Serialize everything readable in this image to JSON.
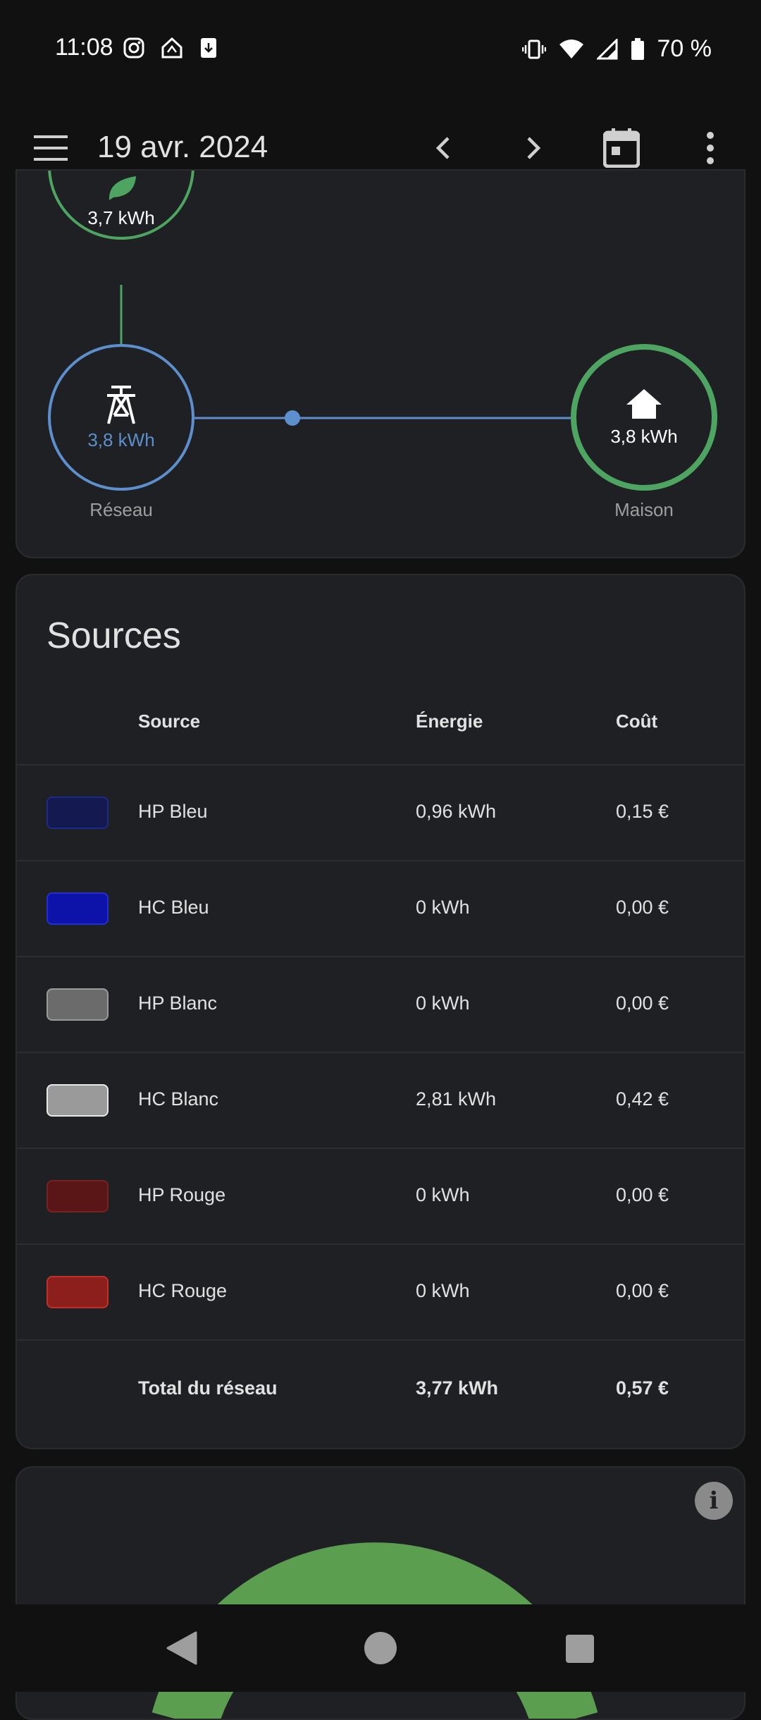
{
  "status_bar": {
    "time": "11:08",
    "battery": "70 %",
    "icons_left": [
      "instagram-icon",
      "home-assistant-icon",
      "download-icon"
    ],
    "icons_right": [
      "vibrate-icon",
      "wifi-icon",
      "signal-icon",
      "battery-icon"
    ]
  },
  "app_bar": {
    "date": "19 avr. 2024",
    "icons": [
      "menu-icon",
      "chevron-left-icon",
      "chevron-right-icon",
      "calendar-icon",
      "more-vert-icon"
    ]
  },
  "energy_flow": {
    "solar": {
      "value": "3,7 kWh",
      "icon": "leaf-icon"
    },
    "grid": {
      "value": "3,8 kWh",
      "label": "Réseau",
      "icon": "transmission-tower-icon"
    },
    "home": {
      "value": "3,8 kWh",
      "label": "Maison",
      "icon": "home-icon"
    },
    "colors": {
      "solar": "#4ea561",
      "grid": "#5c8fcc",
      "home": "#4ea561"
    }
  },
  "sources": {
    "title": "Sources",
    "headers": {
      "source": "Source",
      "energy": "Énergie",
      "cost": "Coût"
    },
    "rows": [
      {
        "name": "HP Bleu",
        "energy": "0,96 kWh",
        "cost": "0,15 €",
        "fill": "#141a4f",
        "border": "#1e2a8a"
      },
      {
        "name": "HC Bleu",
        "energy": "0 kWh",
        "cost": "0,00 €",
        "fill": "#0d13a8",
        "border": "#2030d0"
      },
      {
        "name": "HP Blanc",
        "energy": "0 kWh",
        "cost": "0,00 €",
        "fill": "#6b6b6b",
        "border": "#9a9a9a"
      },
      {
        "name": "HC Blanc",
        "energy": "2,81 kWh",
        "cost": "0,42 €",
        "fill": "#9a9a9a",
        "border": "#e8e8e8"
      },
      {
        "name": "HP Rouge",
        "energy": "0 kWh",
        "cost": "0,00 €",
        "fill": "#5a1616",
        "border": "#7a2020"
      },
      {
        "name": "HC Rouge",
        "energy": "0 kWh",
        "cost": "0,00 €",
        "fill": "#8c1f1c",
        "border": "#c03028"
      }
    ],
    "total": {
      "label": "Total du réseau",
      "energy": "3,77 kWh",
      "cost": "0,57 €"
    }
  },
  "gauge": {
    "color": "#5b9e4f",
    "info_icon": "info-icon",
    "info_glyph": "i"
  },
  "nav_bar": {
    "icons": [
      "back-icon",
      "home-nav-icon",
      "recents-icon"
    ]
  }
}
